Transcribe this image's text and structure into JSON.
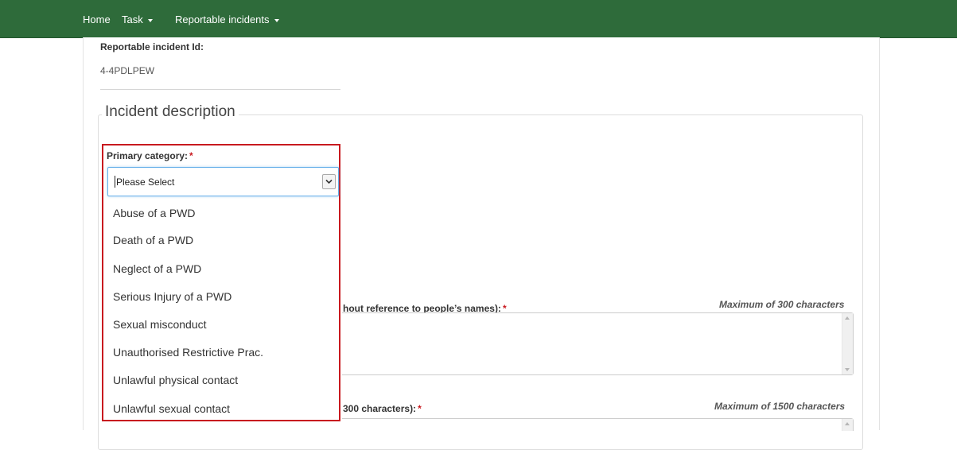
{
  "nav": {
    "home": "Home",
    "task": "Task",
    "reportable": "Reportable incidents"
  },
  "incident": {
    "id_label": "Reportable incident Id:",
    "id_value": "4-4PDLPEW"
  },
  "section": {
    "legend": "Incident description"
  },
  "primary_category": {
    "label": "Primary category:",
    "required_mark": "*",
    "selected": "Please Select",
    "options": [
      "Abuse of a PWD",
      "Death of a PWD",
      "Neglect of a PWD",
      "Serious Injury of a PWD",
      "Sexual misconduct",
      "Unauthorised Restrictive Prac.",
      "Unlawful physical contact",
      "Unlawful sexual contact"
    ]
  },
  "summary_field": {
    "label_visible": "hout reference to people’s names):",
    "required_mark": "*",
    "max_note": "Maximum of 300 characters"
  },
  "detail_field": {
    "label_visible": "300 characters):",
    "required_mark": "*",
    "max_note": "Maximum of 1500 characters"
  },
  "colors": {
    "navbar": "#2e6b3a",
    "highlight": "#c8191f",
    "focus": "#66afe9"
  }
}
